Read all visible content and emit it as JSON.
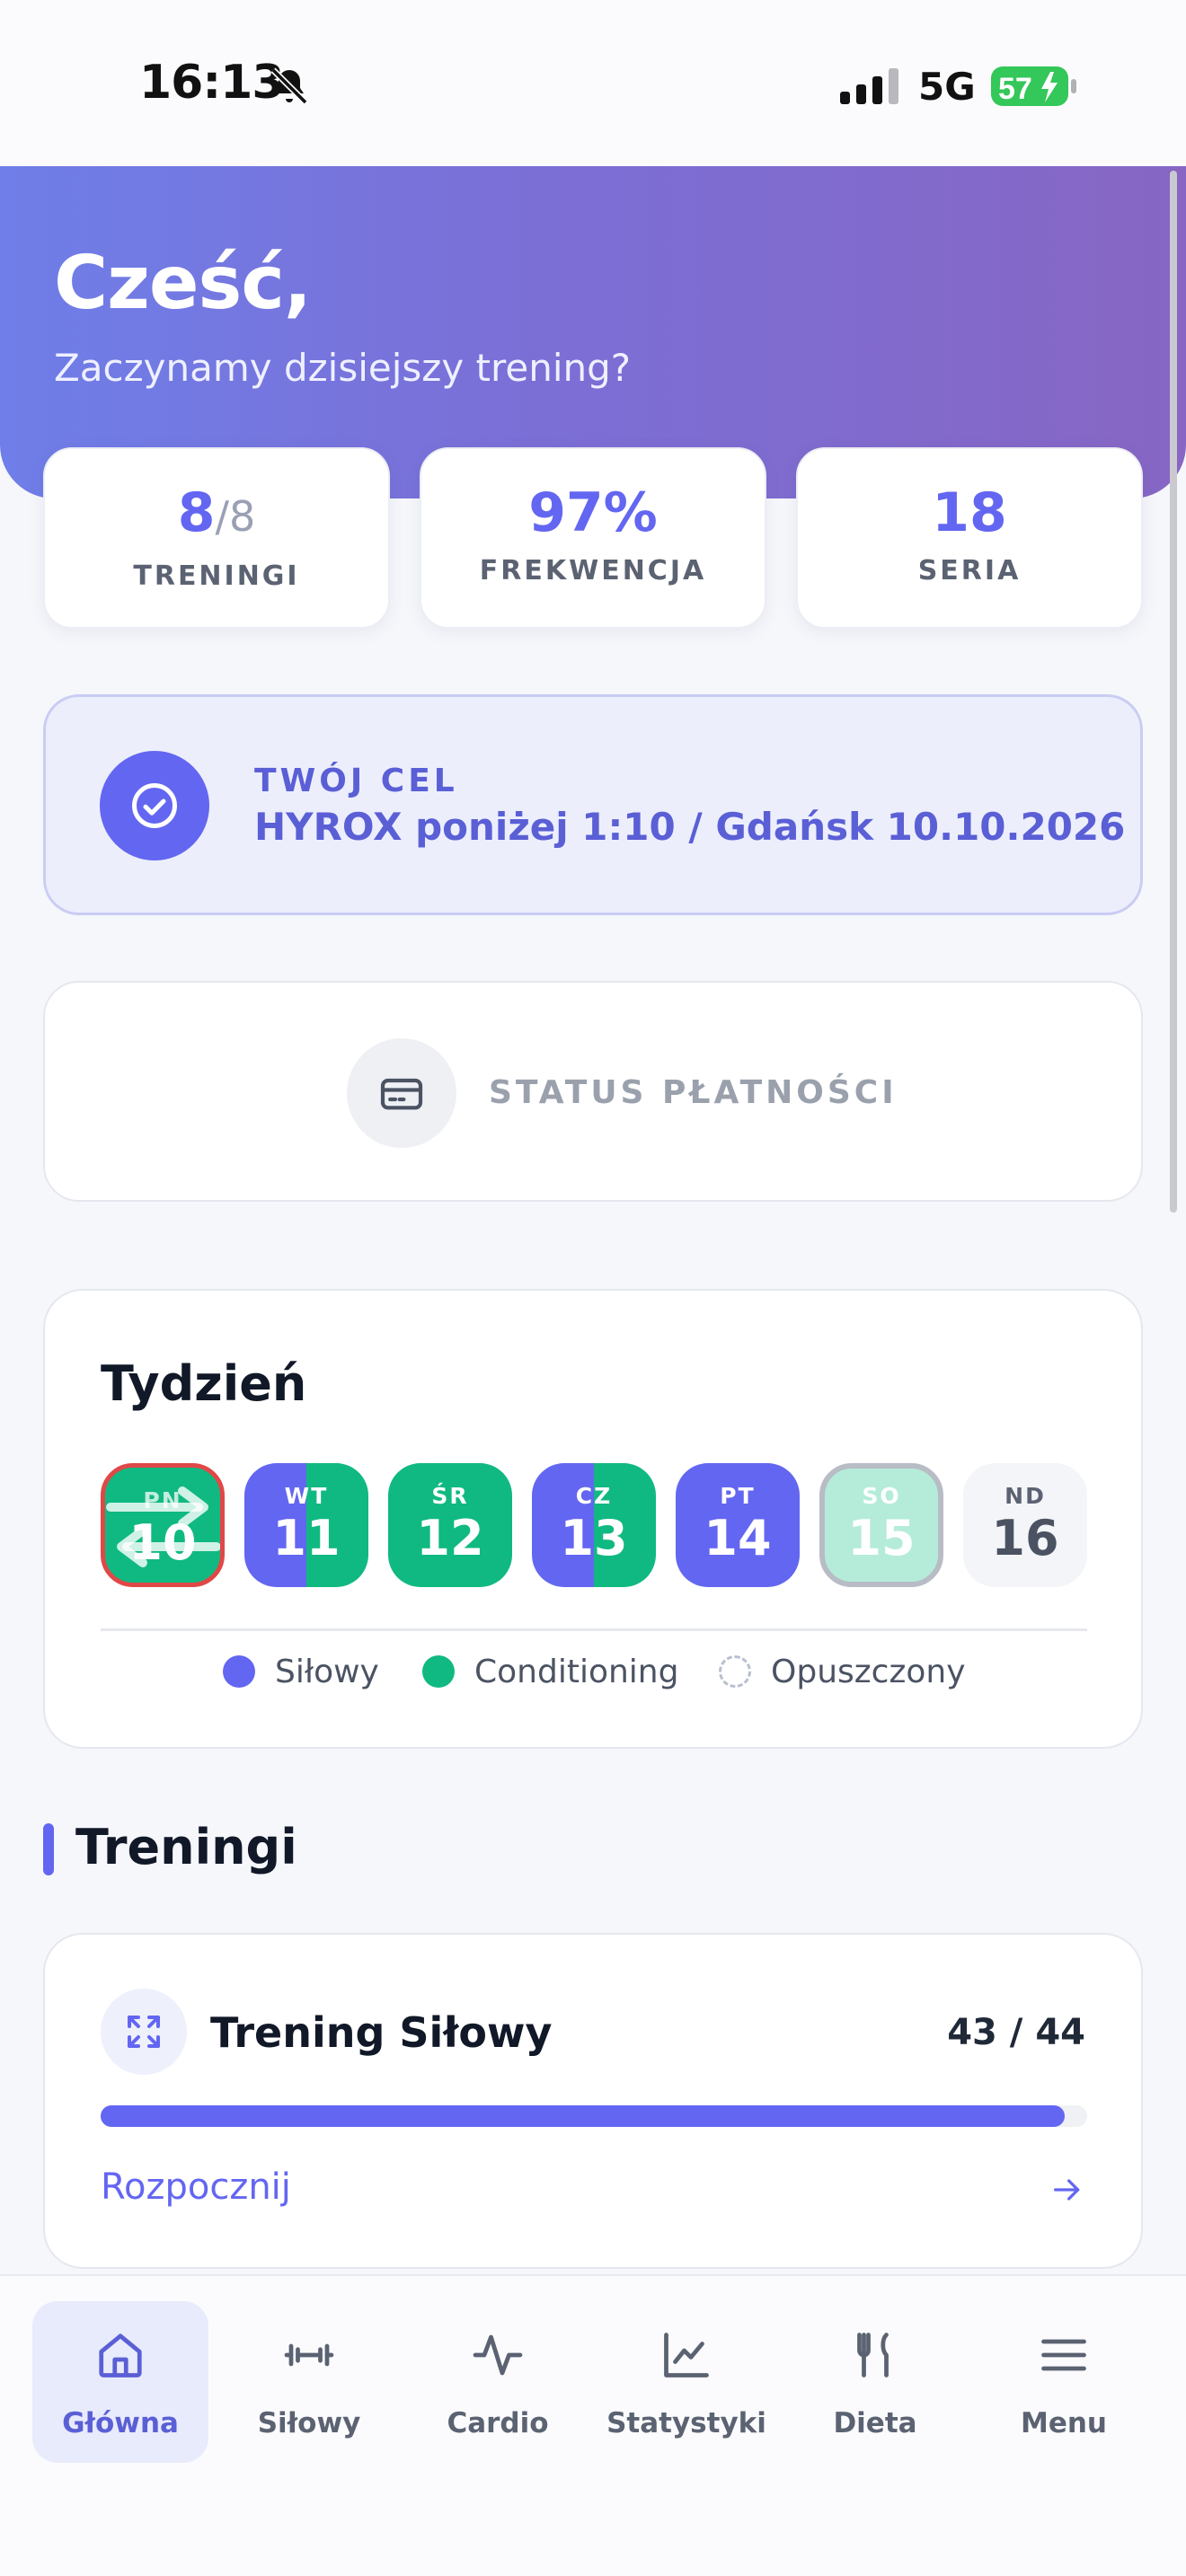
{
  "status_bar": {
    "time": "16:13",
    "network": "5G",
    "battery": "57"
  },
  "header": {
    "greeting": "Cześć,",
    "subtitle": "Zaczynamy dzisiejszy trening?"
  },
  "stats": [
    {
      "value": "8",
      "total": "/8",
      "label": "TRENINGI"
    },
    {
      "value": "97%",
      "label": "FREKWENCJA"
    },
    {
      "value": "18",
      "label": "SERIA"
    }
  ],
  "goal": {
    "title": "TWÓJ CEL",
    "value": "HYROX poniżej 1:10 / Gdańsk 10.10.2026"
  },
  "payment": {
    "title": "STATUS PŁATNOŚCI"
  },
  "week": {
    "title": "Tydzień",
    "days": [
      {
        "name": "PN",
        "num": "10",
        "type": "conditioning-today"
      },
      {
        "name": "WT",
        "num": "11",
        "type": "mixed"
      },
      {
        "name": "ŚR",
        "num": "12",
        "type": "conditioning"
      },
      {
        "name": "CZ",
        "num": "13",
        "type": "mixed"
      },
      {
        "name": "PT",
        "num": "14",
        "type": "silowy"
      },
      {
        "name": "SO",
        "num": "15",
        "type": "conditioning-planned"
      },
      {
        "name": "ND",
        "num": "16",
        "type": "none"
      }
    ],
    "legend": [
      "Siłowy",
      "Conditioning",
      "Opuszczony"
    ]
  },
  "colors": {
    "accent": "#6366f1",
    "green": "#10b981",
    "today_border": "#e04848"
  },
  "section": {
    "title": "Treningi"
  },
  "workout": {
    "title": "Trening Siłowy",
    "count": "43 / 44",
    "progress": 0.977,
    "link": "Rozpocznij"
  },
  "nav": [
    {
      "label": "Główna",
      "icon": "home-icon",
      "active": true
    },
    {
      "label": "Siłowy",
      "icon": "dumbbell-icon",
      "active": false
    },
    {
      "label": "Cardio",
      "icon": "pulse-icon",
      "active": false
    },
    {
      "label": "Statystyki",
      "icon": "chart-icon",
      "active": false
    },
    {
      "label": "Dieta",
      "icon": "fork-knife-icon",
      "active": false
    },
    {
      "label": "Menu",
      "icon": "menu-icon",
      "active": false
    }
  ]
}
